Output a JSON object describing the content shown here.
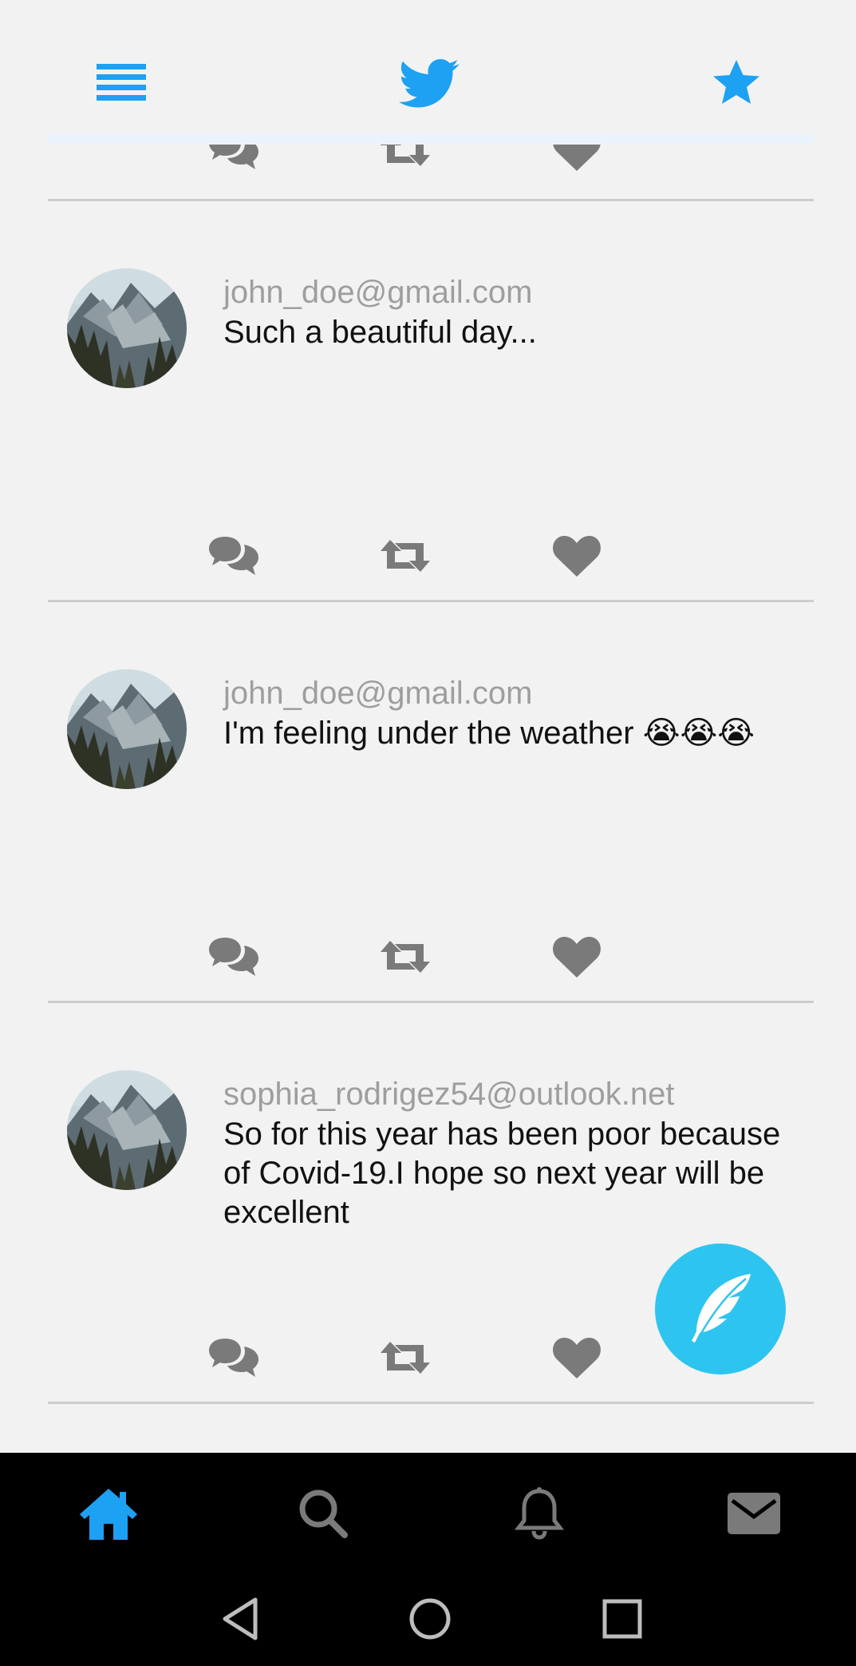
{
  "colors": {
    "accent": "#1da1f2",
    "background": "#f2f2f2",
    "icon_gray": "#7a7a7a",
    "fab": "#2ec4f0",
    "nav_bar": "#000000"
  },
  "header": {
    "icons": [
      "menu-icon",
      "twitter-bird-icon",
      "star-icon"
    ]
  },
  "tweets": [
    {
      "author": "john_doe@gmail.com",
      "text": "Such a beautiful day..."
    },
    {
      "author": "john_doe@gmail.com",
      "text": " I'm feeling under the weather 😭😭😭"
    },
    {
      "author": "sophia_rodrigez54@outlook.net",
      "text": "So for this year has been poor because of Covid-19.I hope so next year will be excellent"
    }
  ],
  "tweet_actions": [
    "reply-icon",
    "retweet-icon",
    "like-icon"
  ],
  "bottom_nav": {
    "items": [
      "home-icon",
      "search-icon",
      "notifications-icon",
      "messages-icon"
    ],
    "active": "home-icon"
  },
  "system_nav": [
    "back-icon",
    "home-circle-icon",
    "recents-icon"
  ]
}
